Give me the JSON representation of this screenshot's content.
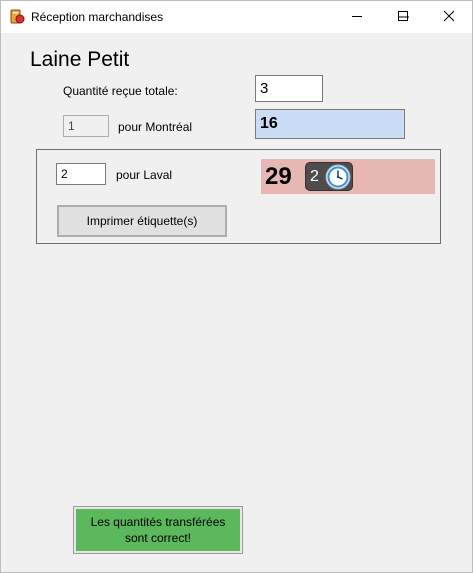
{
  "window": {
    "title": "Réception marchandises",
    "icon": "app-icon"
  },
  "product": {
    "name": "Laine Petit"
  },
  "total": {
    "label": "Quantité reçue totale:",
    "value": "3"
  },
  "montreal": {
    "qty": "1",
    "label": "pour Montréal",
    "stock": "16"
  },
  "laval": {
    "qty": "2",
    "label": "pour Laval",
    "stock": "29",
    "badge_count": "2",
    "badge_icon": "clock-icon"
  },
  "buttons": {
    "print": "Imprimer étiquette(s)",
    "confirm_line1": "Les quantités transférées",
    "confirm_line2": "sont correct!"
  },
  "colors": {
    "montreal_bg": "#cadcf6",
    "laval_bg": "#e7b7b3",
    "confirm_bg": "#5cb85c"
  }
}
